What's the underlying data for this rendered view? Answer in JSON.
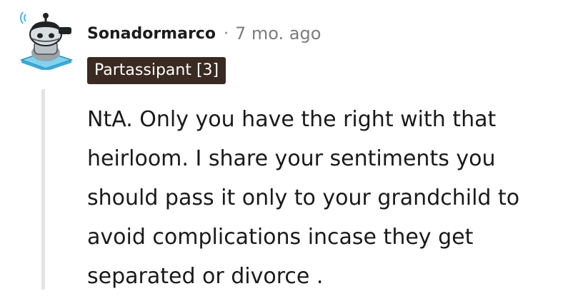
{
  "comment": {
    "author": "Sonadormarco",
    "separator": "·",
    "timestamp": "7 mo. ago",
    "flair": "Partassipant [3]",
    "body": "NtA. Only you have the right with that\nheirloom. I share your sentiments you\nshould pass it only to your grandchild to\navoid complications incase they get\nseparated or divorce .",
    "avatar_icon": "snoo-avatar-icon"
  },
  "colors": {
    "flair_background": "#3a2a22",
    "flair_text": "#ffffff",
    "username": "#1c1c1c",
    "metadata": "#7c7c7c",
    "thread_line": "#e4e4e4"
  }
}
